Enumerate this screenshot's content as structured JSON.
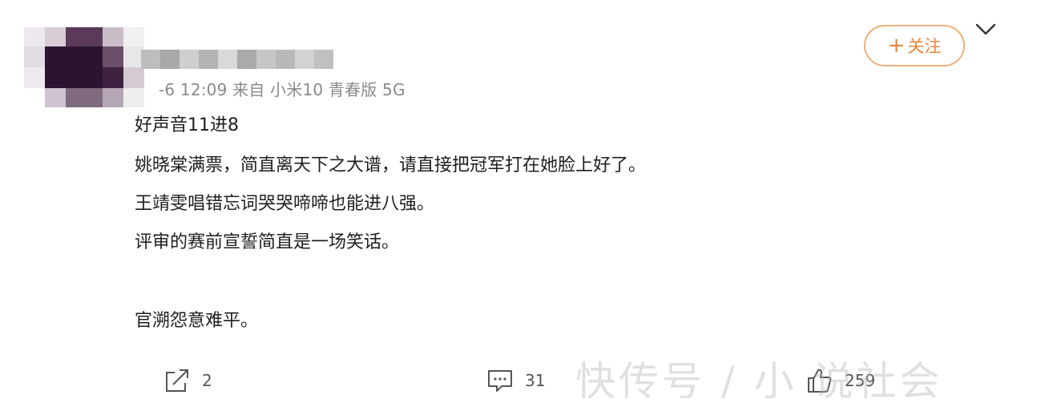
{
  "post": {
    "meta": "-6 12:09  来自 小米10 青春版 5G",
    "lines": [
      "好声音11进8",
      "姚晓棠满票，简直离天下之大谱，请直接把冠军打在她脸上好了。",
      "王靖雯唱错忘词哭哭啼啼也能进八强。",
      "评审的赛前宣誓简直是一场笑话。",
      "",
      "官溯怨意难平。"
    ]
  },
  "header": {
    "follow_label": "关注",
    "follow_plus": "+",
    "colors": {
      "accent": "#e6843c",
      "border": "#f0b07a"
    }
  },
  "actions": {
    "share_count": "2",
    "comment_count": "31",
    "like_count": "259"
  },
  "watermark": "快传号 / 小 说社会"
}
